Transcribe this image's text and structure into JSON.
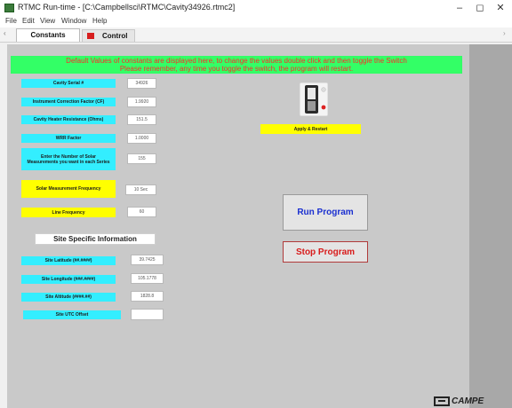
{
  "window": {
    "title": "RTMC Run-time - [C:\\Campbellsci\\RTMC\\Cavity34926.rtmc2]",
    "minimize_glyph": "–",
    "maximize_glyph": "◻",
    "close_glyph": "✕"
  },
  "menu": [
    "File",
    "Edit",
    "View",
    "Window",
    "Help"
  ],
  "tabs": {
    "scroll_left": "‹",
    "scroll_right": "›",
    "constants": "Constants",
    "control": "Control"
  },
  "banner": {
    "line1": "Default Values of constants are displayed here, to change the values double click  and then toggle the Switch",
    "line2": "Please remember, any time you toggle the switch, the program will restart."
  },
  "fields": [
    {
      "label": "Cavity Serial #",
      "value": "34926"
    },
    {
      "label": "Instrument Correction Factor (CF)",
      "value": "1.9920"
    },
    {
      "label": "Cavity Heater Resistance (Ohms)",
      "value": "151.5"
    },
    {
      "label": "WRR Factor",
      "value": "1.0000"
    },
    {
      "label": "Enter the Number of Solar Measurements you want in each Series",
      "value": "155"
    },
    {
      "label": "Solar Measurement Frequency",
      "value": "10 Sec"
    },
    {
      "label": "Line Frequency",
      "value": "60"
    }
  ],
  "site": {
    "header": "Site Specific Information",
    "fields": [
      {
        "label": "Site Latitude (##.####)",
        "value": "39.7425"
      },
      {
        "label": "Site Longitude (###.####)",
        "value": "105.1778"
      },
      {
        "label": "Site Altitude (####.##)",
        "value": "1828.8"
      },
      {
        "label": "Site UTC Offset",
        "value": ""
      }
    ]
  },
  "controls": {
    "apply_label": "Apply & Restart",
    "run_button": "Run Program",
    "stop_button": "Stop Program"
  },
  "logo": {
    "text": "CAMPE"
  },
  "colors": {
    "banner_bg": "#33ff66",
    "banner_text": "#ff2a2a",
    "label_cyan": "#33eeff",
    "label_yellow": "#ffff00",
    "run_text": "#1a2fd0",
    "stop_text": "#d81b1b"
  }
}
